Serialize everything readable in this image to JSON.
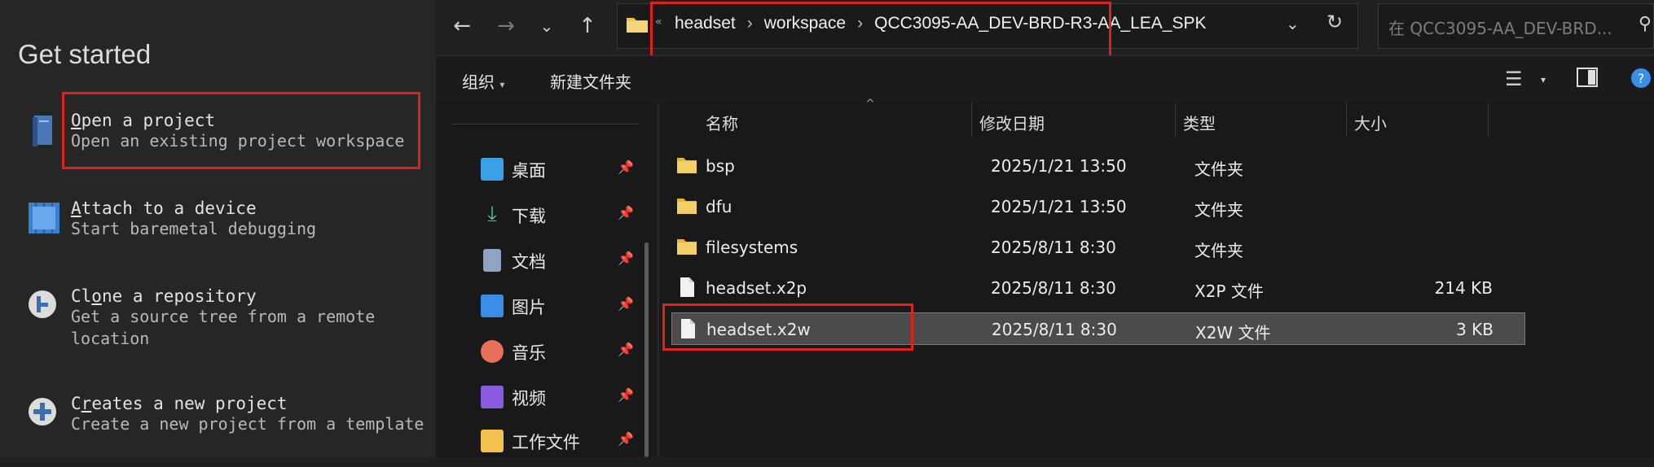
{
  "left_panel": {
    "title": "Get started",
    "items": [
      {
        "title_first": "O",
        "title_rest": "pen a project",
        "desc": "Open an existing project workspace",
        "icon": "book-icon"
      },
      {
        "title_first": "A",
        "title_rest": "ttach to a device",
        "desc": "Start baremetal debugging",
        "icon": "chip-icon"
      },
      {
        "title_first": "Cl",
        "title_rest_ul": "o",
        "title_rest": "ne a repository",
        "desc": "Get a source tree from a remote location",
        "icon": "git-icon"
      },
      {
        "title_first": "C",
        "title_rest_ul": "r",
        "title_rest": "eates a new project",
        "desc": "Create a new project from a template",
        "icon": "plus-circle-icon"
      }
    ]
  },
  "explorer": {
    "breadcrumb": [
      "headset",
      "workspace",
      "QCC3095-AA_DEV-BRD-R3-AA_LEA_SPK"
    ],
    "search_placeholder": "在 QCC3095-AA_DEV-BRD...",
    "commands": {
      "organize": "组织",
      "new_folder": "新建文件夹"
    },
    "quick_access": [
      {
        "label": "桌面",
        "icon": "desktop-icon",
        "color": "#3aa0e8"
      },
      {
        "label": "下载",
        "icon": "download-icon",
        "color": "#3cc8a0"
      },
      {
        "label": "文档",
        "icon": "document-icon",
        "color": "#8fa4c2"
      },
      {
        "label": "图片",
        "icon": "picture-icon",
        "color": "#3a8ee8"
      },
      {
        "label": "音乐",
        "icon": "music-icon",
        "color": "#e8705a"
      },
      {
        "label": "视频",
        "icon": "video-icon",
        "color": "#8a5ae0"
      },
      {
        "label": "工作文件",
        "icon": "folder-icon",
        "color": "#f2c14e"
      }
    ],
    "columns": {
      "name": "名称",
      "date": "修改日期",
      "type": "类型",
      "size": "大小"
    },
    "files": [
      {
        "name": "bsp",
        "date": "2025/1/21 13:50",
        "type": "文件夹",
        "size": "",
        "kind": "folder"
      },
      {
        "name": "dfu",
        "date": "2025/1/21 13:50",
        "type": "文件夹",
        "size": "",
        "kind": "folder"
      },
      {
        "name": "filesystems",
        "date": "2025/8/11 8:30",
        "type": "文件夹",
        "size": "",
        "kind": "folder"
      },
      {
        "name": "headset.x2p",
        "date": "2025/8/11 8:30",
        "type": "X2P 文件",
        "size": "214 KB",
        "kind": "file"
      },
      {
        "name": "headset.x2w",
        "date": "2025/8/11 8:30",
        "type": "X2W 文件",
        "size": "3 KB",
        "kind": "file",
        "selected": true
      }
    ],
    "accent_red": "#e0201b"
  }
}
